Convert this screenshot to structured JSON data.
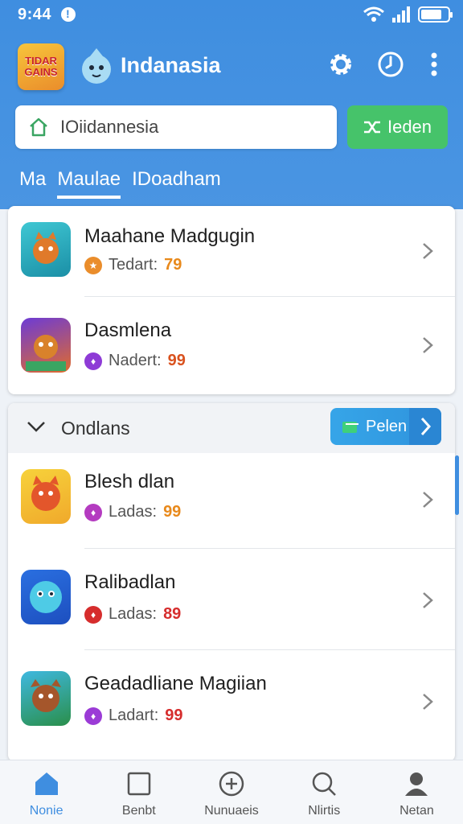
{
  "status_bar": {
    "time": "9:44"
  },
  "header": {
    "logo_text": "TIDAR GAINS",
    "title": "Indanasia",
    "icons": [
      "settings-icon",
      "clock-icon",
      "more-vertical-icon"
    ]
  },
  "search": {
    "value": "IOiidannesia"
  },
  "action_button": {
    "label": "Ieden"
  },
  "tabs": [
    {
      "label": "Ma"
    },
    {
      "label": "Maulae"
    },
    {
      "label": "IDoadham"
    }
  ],
  "featured": [
    {
      "name": "Maahane Madgugin",
      "meta_label": "Tedart:",
      "value": "79",
      "dot_color": "#ea8d2b",
      "value_color": "#e8891b",
      "dot_glyph": "★"
    },
    {
      "name": "Dasmlena",
      "meta_label": "Nadert:",
      "value": "99",
      "dot_color": "#8e3bd6",
      "value_color": "#d9521f",
      "dot_glyph": "♦"
    }
  ],
  "section": {
    "title": "Ondlans",
    "pill_label": "Pelen",
    "items": [
      {
        "name": "Blesh dlan",
        "meta_label": "Ladas:",
        "value": "99",
        "dot_color": "#b43bc0",
        "value_color": "#e8891b",
        "dot_glyph": "♦"
      },
      {
        "name": "Ralibadlan",
        "meta_label": "Ladas:",
        "value": "89",
        "dot_color": "#d62d2d",
        "value_color": "#d62d2d",
        "dot_glyph": "♦"
      },
      {
        "name": "Geadadliane Magiian",
        "meta_label": "Ladart:",
        "value": "99",
        "dot_color": "#9b3bd6",
        "value_color": "#d62d2d",
        "dot_glyph": "♦"
      }
    ]
  },
  "bottom_nav": [
    {
      "label": "Nonie",
      "icon": "home-icon"
    },
    {
      "label": "Benbt",
      "icon": "square-icon"
    },
    {
      "label": "Nunuaeis",
      "icon": "plus-circle-icon"
    },
    {
      "label": "Nlirtis",
      "icon": "search-icon"
    },
    {
      "label": "Netan",
      "icon": "profile-icon"
    }
  ],
  "colors": {
    "primary": "#3f8ee0",
    "accent_green": "#46c36a"
  }
}
